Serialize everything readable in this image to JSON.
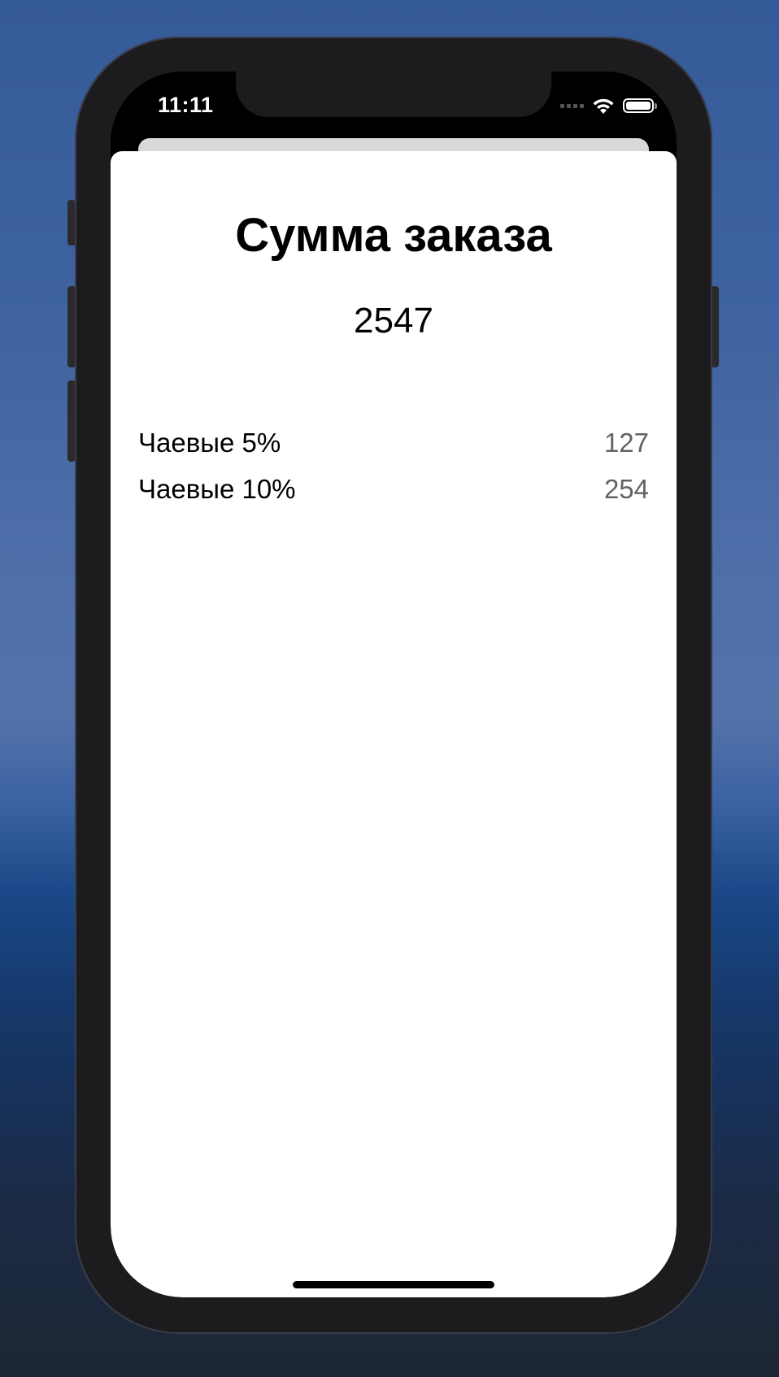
{
  "status_bar": {
    "time": "11:11",
    "icons": [
      "signal-icon",
      "wifi-icon",
      "battery-icon"
    ]
  },
  "sheet": {
    "title": "Сумма заказа",
    "total": "2547",
    "tips": [
      {
        "label": "Чаевые 5%",
        "value": "127"
      },
      {
        "label": "Чаевые 10%",
        "value": "254"
      }
    ]
  },
  "colors": {
    "sheet_background": "#ffffff",
    "tip_value": "#636366",
    "phone_frame": "#1c1c1e"
  }
}
